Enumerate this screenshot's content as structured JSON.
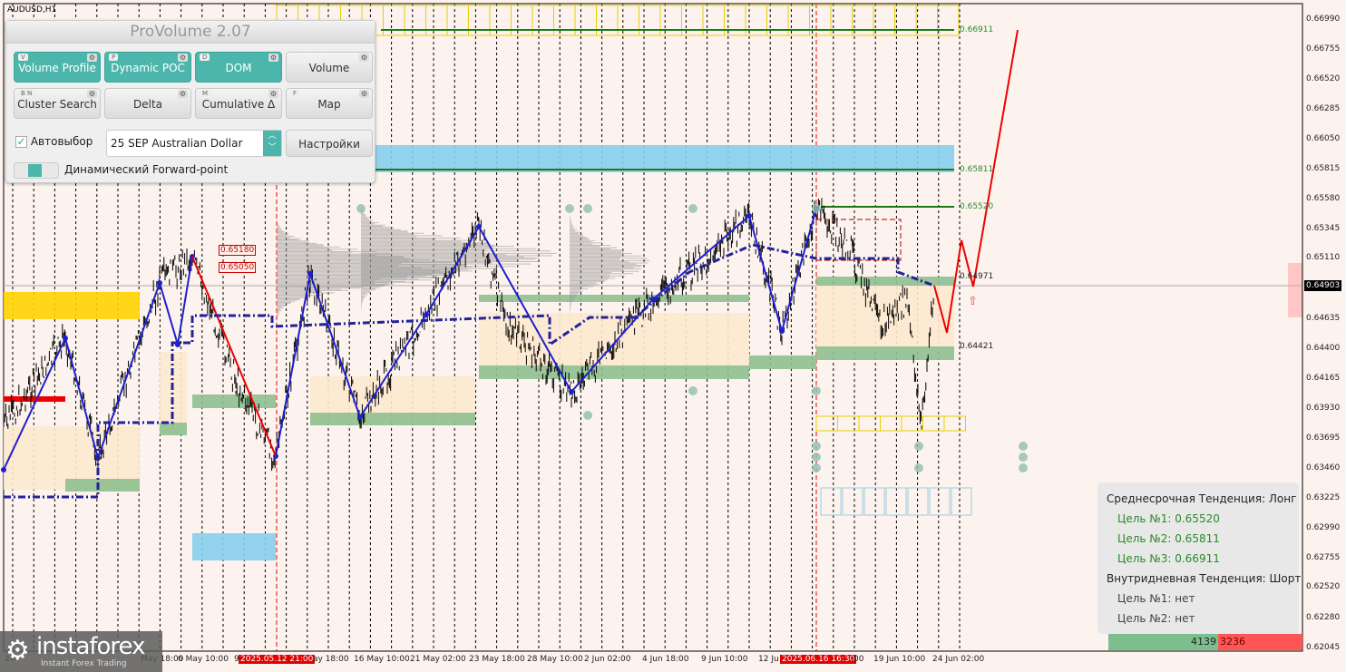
{
  "symbol": "AUDUSD,H1",
  "panel": {
    "title": "ProVolume 2.07",
    "buttons": [
      {
        "key": "V",
        "label": "Volume Profile",
        "on": true
      },
      {
        "key": "P",
        "label": "Dynamic POC",
        "on": true
      },
      {
        "key": "D",
        "label": "DOM",
        "on": true
      },
      {
        "key": "",
        "label": "Volume",
        "on": false
      },
      {
        "key": "B N",
        "label": "Cluster Search",
        "on": false
      },
      {
        "key": "",
        "label": "Delta",
        "on": false
      },
      {
        "key": "M",
        "label": "Cumulative Δ",
        "on": false
      },
      {
        "key": "F",
        "label": "Map",
        "on": false
      }
    ],
    "autoselect": "Автовыбор",
    "instrument": "25 SEP Australian Dollar",
    "settings": "Настройки",
    "forward": "Динамический Forward-point"
  },
  "price_axis": [
    "0.66990",
    "0.66755",
    "0.66520",
    "0.66285",
    "0.66050",
    "0.65815",
    "0.65580",
    "0.65345",
    "0.65110",
    "0.64635",
    "0.64400",
    "0.64165",
    "0.63930",
    "0.63695",
    "0.63460",
    "0.63225",
    "0.62990",
    "0.62755",
    "0.62520",
    "0.62280",
    "0.62045"
  ],
  "current_price": "0.64903",
  "time_axis": [
    "24",
    "May 18:00",
    "6 May 10:00",
    "9",
    "2025.05.12 21:00",
    "ay 18:00",
    "16 May 10:00",
    "21 May 02:00",
    "23 May 18:00",
    "28 May 10:00",
    "2 Jun 02:00",
    "4 Jun 18:00",
    "9 Jun 10:00",
    "12 Ju",
    "2025.06.16 16:30",
    ":00",
    "19 Jun 10:00",
    "24 Jun 02:00"
  ],
  "levels": {
    "l1": "0.66911",
    "l2": "0.65811",
    "l3": "0.65520",
    "l4": "0.64971",
    "l5": "0.64421",
    "r1": "0.65180",
    "r2": "0.65050"
  },
  "info": {
    "mid": "Среднесрочная Тенденция: Лонг",
    "t1": "Цель №1: 0.65520",
    "t2": "Цель №2: 0.65811",
    "t3": "Цель №3: 0.66911",
    "intra": "Внутридневная Тенденция: Шорт",
    "i1": "Цель №1: нет",
    "i2": "Цель №2: нет",
    "buy": "4139",
    "sell": "3236"
  },
  "logo": {
    "name": "instaforex",
    "tagline": "Instant Forex Trading"
  },
  "colors": {
    "teal": "#4db6ac",
    "blue": "#1f1fd0",
    "red": "#e00000",
    "green": "#1a7a1a"
  }
}
